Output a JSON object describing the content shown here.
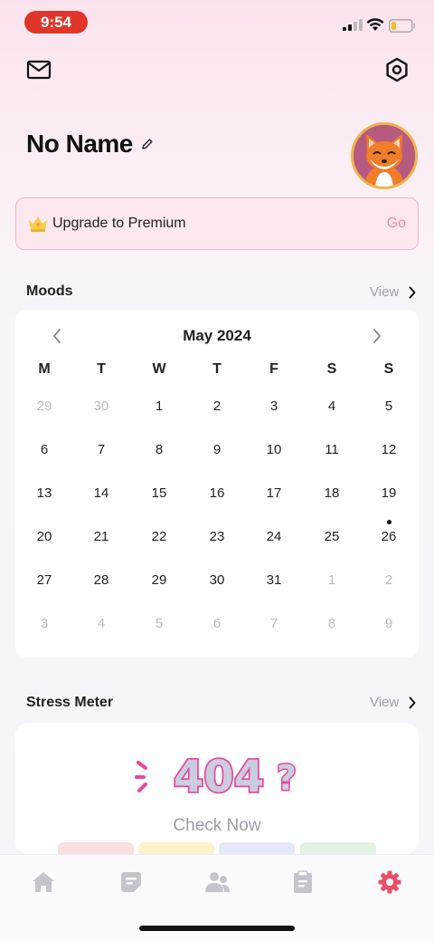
{
  "status_bar": {
    "time": "9:54"
  },
  "header": {
    "mail_icon": "mail-icon",
    "settings_icon": "hexagon-gear-icon"
  },
  "profile": {
    "name": "No Name",
    "edit_icon": "pencil-icon",
    "avatar_icon": "fox-avatar"
  },
  "premium": {
    "icon": "crown-icon",
    "label": "Upgrade to Premium",
    "action": "Go"
  },
  "moods": {
    "title": "Moods",
    "view_label": "View",
    "calendar": {
      "month": "May 2024",
      "weekdays": [
        "M",
        "T",
        "W",
        "T",
        "F",
        "S",
        "S"
      ],
      "weeks": [
        [
          {
            "d": "29",
            "m": true
          },
          {
            "d": "30",
            "m": true
          },
          {
            "d": "1"
          },
          {
            "d": "2"
          },
          {
            "d": "3"
          },
          {
            "d": "4"
          },
          {
            "d": "5"
          }
        ],
        [
          {
            "d": "6"
          },
          {
            "d": "7"
          },
          {
            "d": "8"
          },
          {
            "d": "9"
          },
          {
            "d": "10"
          },
          {
            "d": "11"
          },
          {
            "d": "12"
          }
        ],
        [
          {
            "d": "13"
          },
          {
            "d": "14"
          },
          {
            "d": "15"
          },
          {
            "d": "16"
          },
          {
            "d": "17"
          },
          {
            "d": "18"
          },
          {
            "d": "19"
          }
        ],
        [
          {
            "d": "20"
          },
          {
            "d": "21"
          },
          {
            "d": "22"
          },
          {
            "d": "23"
          },
          {
            "d": "24"
          },
          {
            "d": "25"
          },
          {
            "d": "26",
            "dot": true
          }
        ],
        [
          {
            "d": "27"
          },
          {
            "d": "28"
          },
          {
            "d": "29"
          },
          {
            "d": "30"
          },
          {
            "d": "31"
          },
          {
            "d": "1",
            "m": true
          },
          {
            "d": "2",
            "m": true
          }
        ],
        [
          {
            "d": "3",
            "m": true
          },
          {
            "d": "4",
            "m": true
          },
          {
            "d": "5",
            "m": true
          },
          {
            "d": "6",
            "m": true
          },
          {
            "d": "7",
            "m": true
          },
          {
            "d": "8",
            "m": true
          },
          {
            "d": "9",
            "m": true
          }
        ]
      ]
    }
  },
  "stress": {
    "title": "Stress Meter",
    "view_label": "View",
    "badge_text": "404",
    "check_label": "Check Now",
    "meter_colors": [
      "#f9dfe1",
      "#fdf2cc",
      "#e4e8f9",
      "#e2f2e4"
    ]
  },
  "tabbar": {
    "items": [
      {
        "icon": "home-icon",
        "active": false
      },
      {
        "icon": "journal-icon",
        "active": false
      },
      {
        "icon": "community-icon",
        "active": false
      },
      {
        "icon": "clipboard-icon",
        "active": false
      },
      {
        "icon": "settings-icon",
        "active": true
      }
    ],
    "active_color": "#e8506a",
    "inactive_color": "#c4c4cc"
  }
}
